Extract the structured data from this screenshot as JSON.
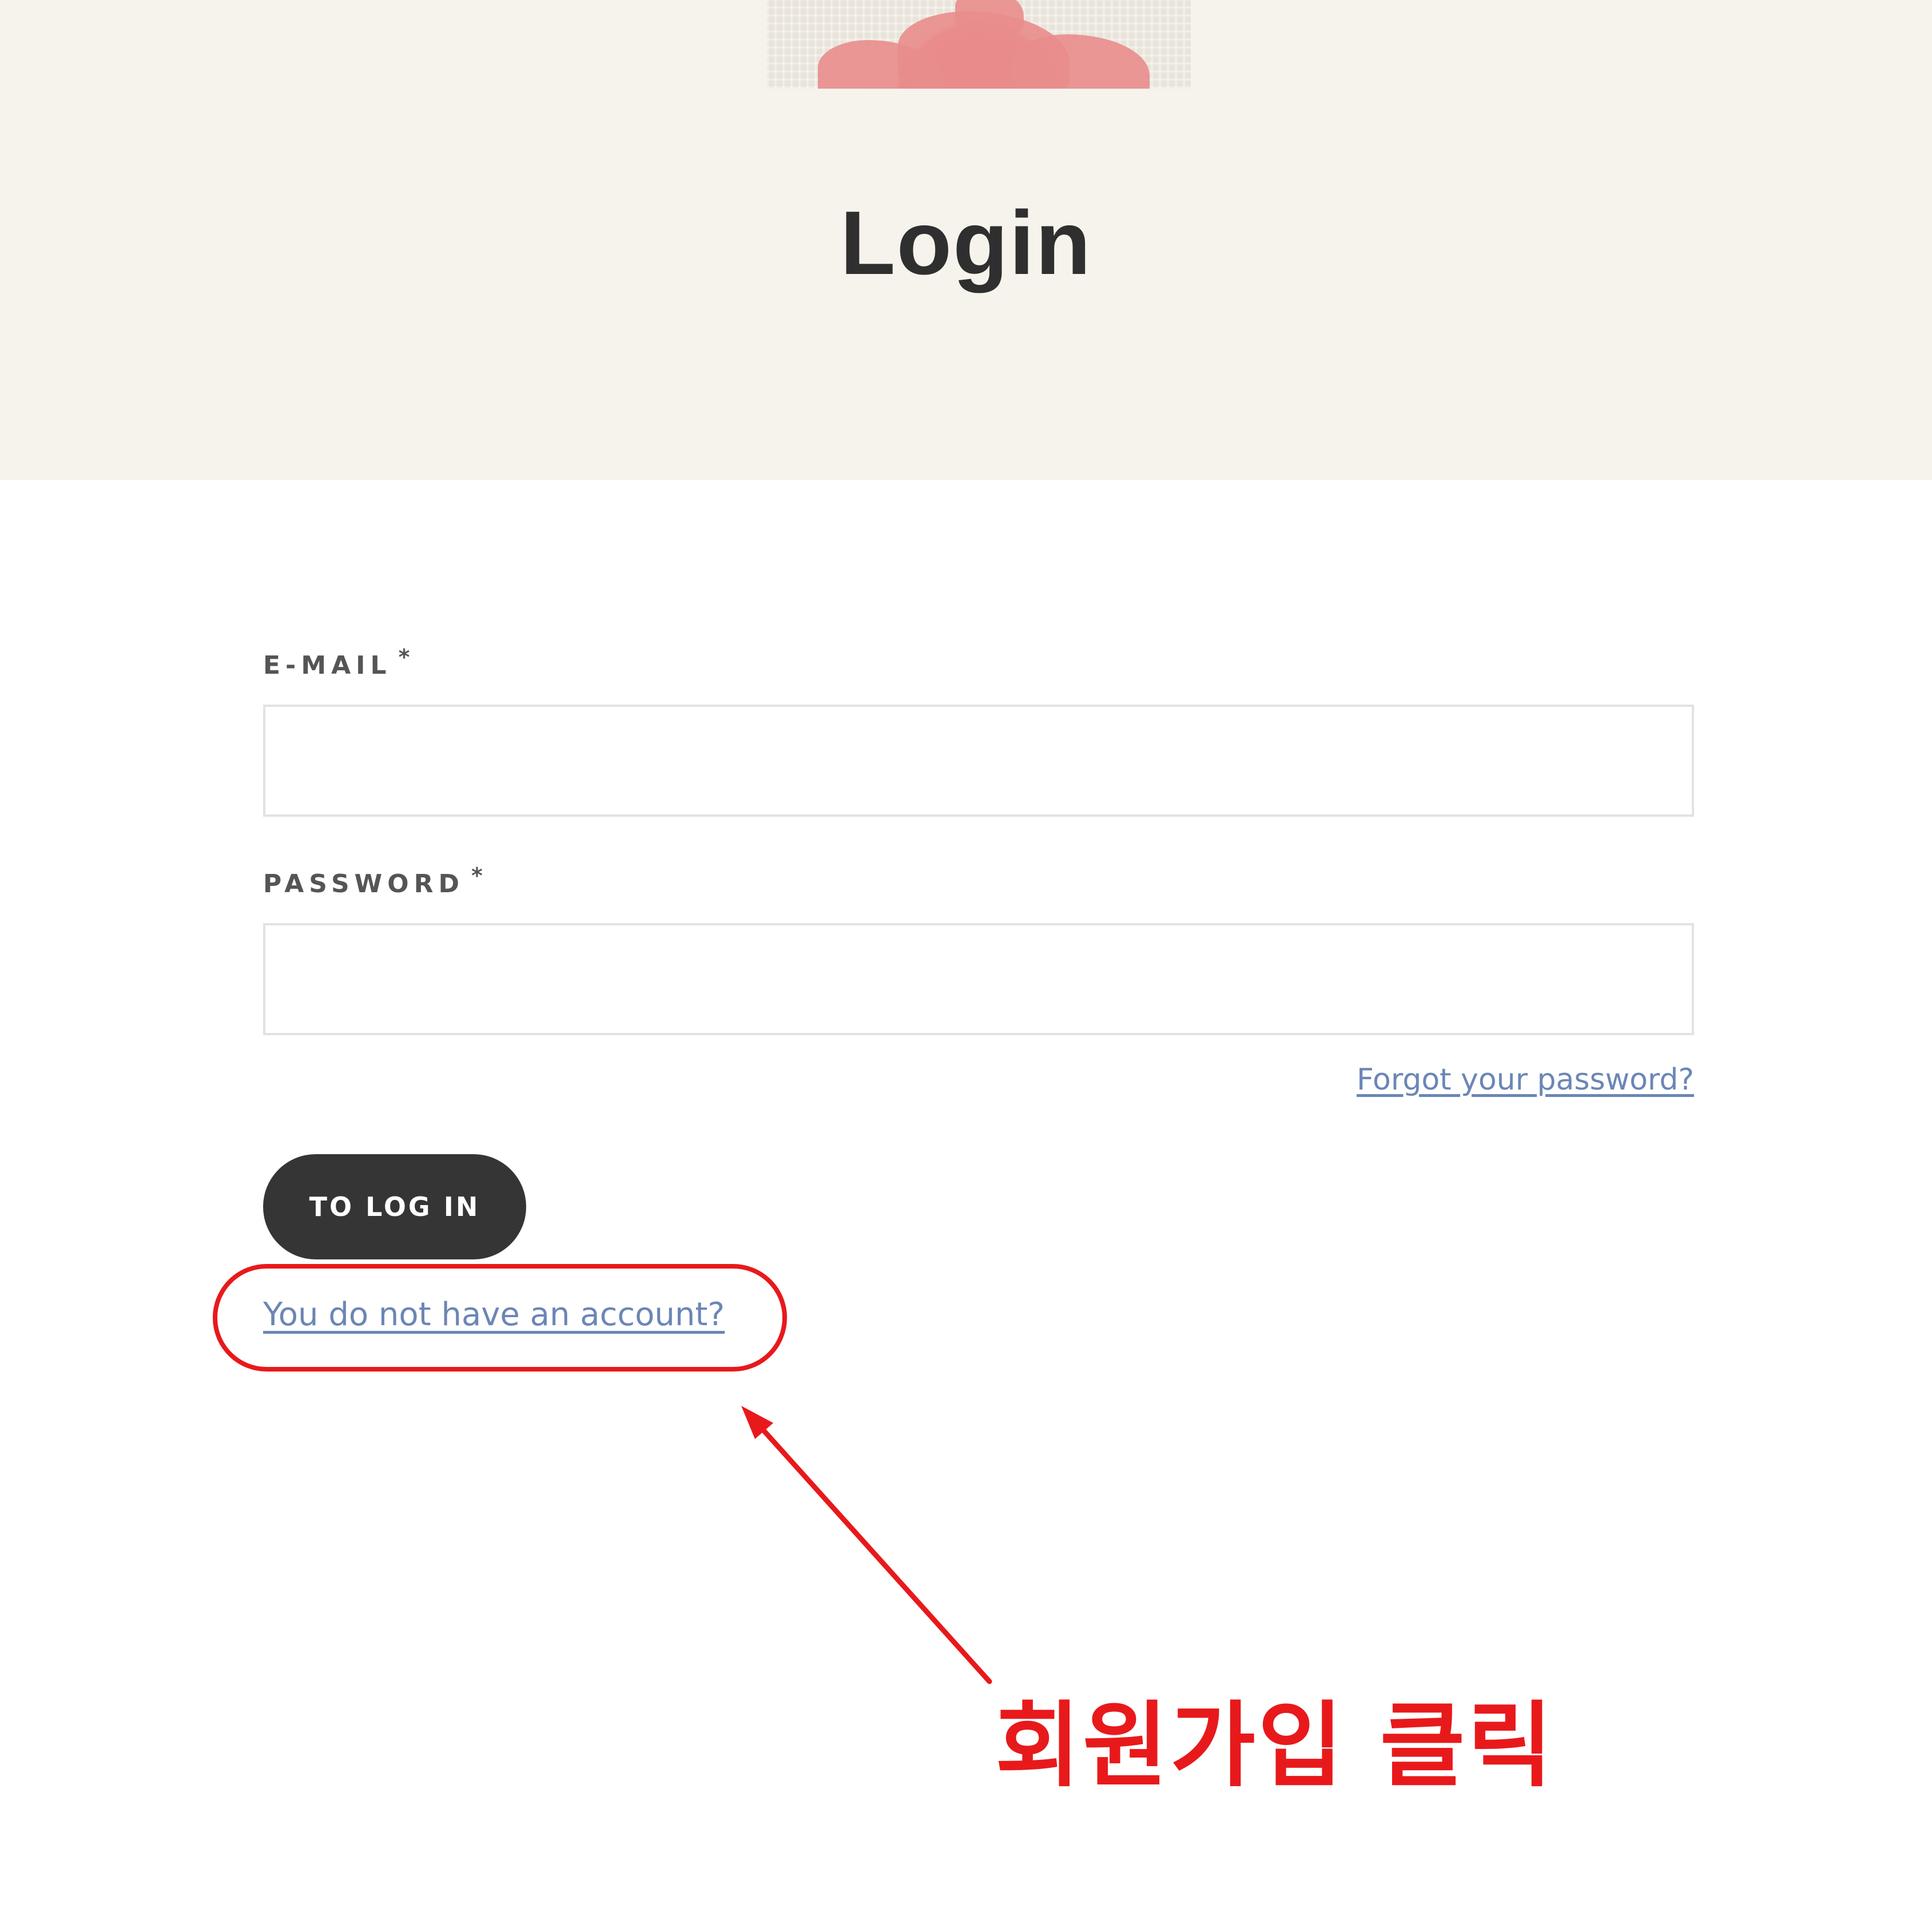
{
  "header": {
    "title": "Login"
  },
  "form": {
    "email": {
      "label": "E-MAIL",
      "required_mark": "*",
      "value": "",
      "placeholder": ""
    },
    "password": {
      "label": "PASSWORD",
      "required_mark": "*",
      "value": "",
      "placeholder": ""
    },
    "forgot_password_link": "Forgot your password?",
    "submit_label": "TO LOG IN",
    "signup_link": "You do not have an account?"
  },
  "annotation": {
    "text": "회원가입 클릭",
    "color": "#e8191b"
  },
  "colors": {
    "hero_background": "#f6f3ec",
    "button_background": "#353535",
    "link": "#6b86b6",
    "annotation": "#e8191b"
  }
}
